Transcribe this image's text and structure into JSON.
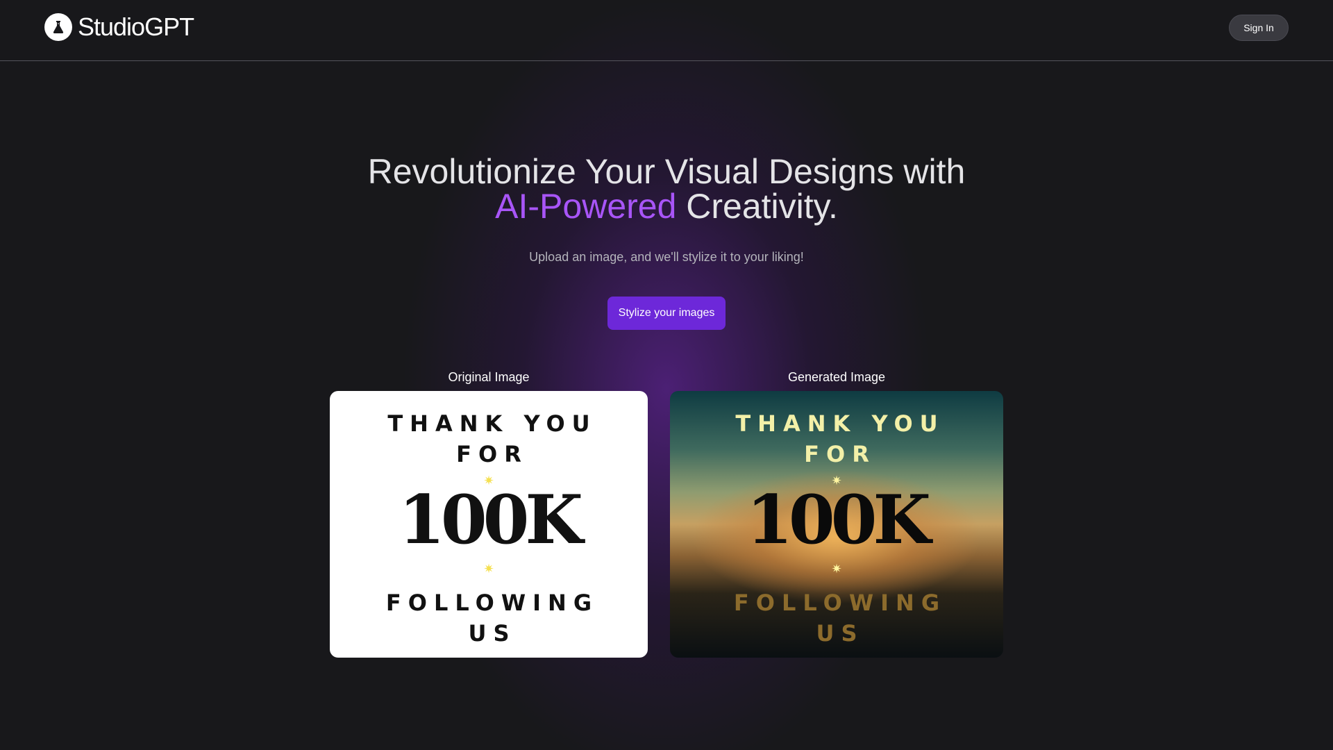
{
  "header": {
    "brand": "StudioGPT",
    "logo_icon": "flask-icon",
    "sign_in_label": "Sign In"
  },
  "hero": {
    "title_line1": "Revolutionize Your Visual Designs with",
    "title_accent": "AI-Powered",
    "title_rest": " Creativity.",
    "subtitle": "Upload an image, and we'll stylize it to your liking!",
    "cta_label": "Stylize your images",
    "accent_color": "#a855f7",
    "button_color": "#6d28d9"
  },
  "gallery": {
    "original": {
      "label": "Original Image",
      "poster": {
        "line1": "THANK YOU",
        "line2": "FOR",
        "big": "100K",
        "line3": "FOLLOWING",
        "line4": "US",
        "star": "✷"
      }
    },
    "generated": {
      "label": "Generated Image",
      "poster": {
        "line1": "THANK YOU",
        "line2": "FOR",
        "big": "100K",
        "line3": "FOLLOWING",
        "line4": "US",
        "star": "✷"
      }
    }
  }
}
